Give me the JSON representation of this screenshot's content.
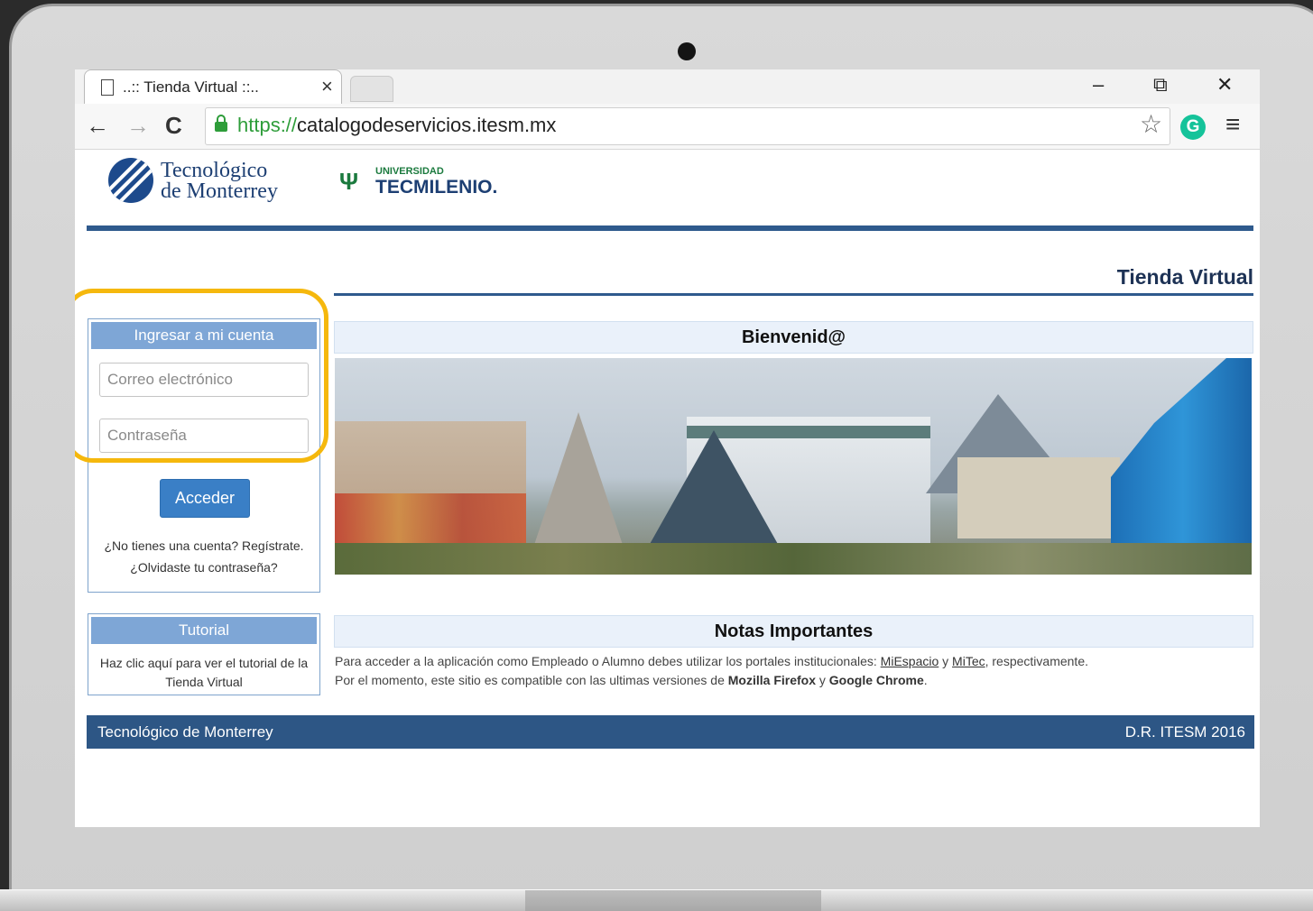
{
  "browser": {
    "tab_title": "..:: Tienda Virtual ::..",
    "tab_close": "×",
    "url_scheme": "https://",
    "url_host": "catalogodeservicios.itesm.mx",
    "window_controls": {
      "minimize": "–",
      "restore": "⧉",
      "close": "✕"
    },
    "nav": {
      "back": "←",
      "forward": "→",
      "reload": "C"
    },
    "bookmark_icon": "☆",
    "extension_icon": "G",
    "menu_icon": "≡"
  },
  "header": {
    "logo_tec_line1": "Tecnológico",
    "logo_tec_line2": "de Monterrey",
    "logo_tecmilenio_top": "UNIVERSIDAD",
    "logo_tecmilenio_bottom": "TECMILENIO.",
    "store_title": "Tienda Virtual"
  },
  "login": {
    "title": "Ingresar a mi cuenta",
    "email_placeholder": "Correo electrónico",
    "password_placeholder": "Contraseña",
    "submit_label": "Acceder",
    "register_text": "¿No tienes una cuenta? Regístrate.",
    "forgot_text": "¿Olvidaste tu contraseña?"
  },
  "tutorial": {
    "title": "Tutorial",
    "description": "Haz clic aquí para ver el tutorial de la Tienda Virtual"
  },
  "welcome": {
    "title": "Bienvenid@"
  },
  "notes": {
    "title": "Notas Importantes",
    "line1_prefix": "Para acceder a la aplicación como Empleado o Alumno debes utilizar los portales institucionales: ",
    "link1": "MiEspacio",
    "line1_mid": " y ",
    "link2": "MiTec",
    "line1_suffix": ", respectivamente.",
    "line2_prefix": "Por el momento, este sitio es compatible con las ultimas versiones de ",
    "browser1": "Mozilla Firefox",
    "line2_mid": " y ",
    "browser2": "Google Chrome",
    "line2_suffix": "."
  },
  "footer": {
    "left": "Tecnológico de Monterrey",
    "right": "D.R. ITESM 2016"
  },
  "colors": {
    "brand_blue": "#2d5685",
    "panel_header": "#7ea6d6",
    "button_blue": "#3a7fc6",
    "highlight": "#f5b80d"
  }
}
